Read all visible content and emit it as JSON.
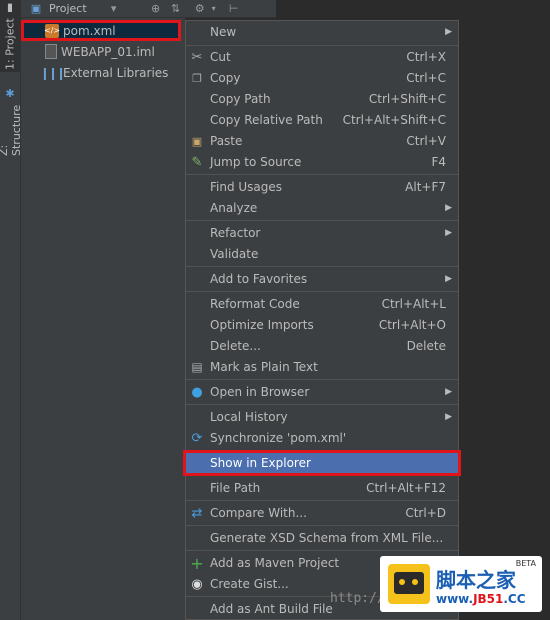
{
  "toolstrip": {
    "project_tab": "1: Project",
    "structure_tab": "Z: Structure"
  },
  "toolbar": {
    "title": "Project",
    "icons": [
      "dropdown-icon",
      "target-icon",
      "collapse-icon",
      "gear-icon",
      "pin-icon"
    ]
  },
  "tree": {
    "items": [
      {
        "label": "pom.xml",
        "icon": "xml-file-icon",
        "selected": true
      },
      {
        "label": "WEBAPP_01.iml",
        "icon": "iml-file-icon",
        "selected": false
      },
      {
        "label": "External Libraries",
        "icon": "libraries-icon",
        "selected": false
      }
    ]
  },
  "menu": {
    "items": [
      {
        "label": "New",
        "shortcut": "",
        "submenu": true,
        "icon": ""
      },
      {
        "label": "Cut",
        "shortcut": "Ctrl+X",
        "submenu": false,
        "icon": "scissors-icon"
      },
      {
        "label": "Copy",
        "shortcut": "Ctrl+C",
        "submenu": false,
        "icon": "copy-icon"
      },
      {
        "label": "Copy Path",
        "shortcut": "Ctrl+Shift+C",
        "submenu": false,
        "icon": ""
      },
      {
        "label": "Copy Relative Path",
        "shortcut": "Ctrl+Alt+Shift+C",
        "submenu": false,
        "icon": ""
      },
      {
        "label": "Paste",
        "shortcut": "Ctrl+V",
        "submenu": false,
        "icon": "paste-icon"
      },
      {
        "label": "Jump to Source",
        "shortcut": "F4",
        "submenu": false,
        "icon": "edit-icon"
      },
      {
        "label": "Find Usages",
        "shortcut": "Alt+F7",
        "submenu": false,
        "icon": ""
      },
      {
        "label": "Analyze",
        "shortcut": "",
        "submenu": true,
        "icon": ""
      },
      {
        "label": "Refactor",
        "shortcut": "",
        "submenu": true,
        "icon": ""
      },
      {
        "label": "Validate",
        "shortcut": "",
        "submenu": false,
        "icon": ""
      },
      {
        "label": "Add to Favorites",
        "shortcut": "",
        "submenu": true,
        "icon": ""
      },
      {
        "label": "Reformat Code",
        "shortcut": "Ctrl+Alt+L",
        "submenu": false,
        "icon": ""
      },
      {
        "label": "Optimize Imports",
        "shortcut": "Ctrl+Alt+O",
        "submenu": false,
        "icon": ""
      },
      {
        "label": "Delete...",
        "shortcut": "Delete",
        "submenu": false,
        "icon": ""
      },
      {
        "label": "Mark as Plain Text",
        "shortcut": "",
        "submenu": false,
        "icon": "plain-text-icon"
      },
      {
        "label": "Open in Browser",
        "shortcut": "",
        "submenu": true,
        "icon": "globe-icon"
      },
      {
        "label": "Local History",
        "shortcut": "",
        "submenu": true,
        "icon": ""
      },
      {
        "label": "Synchronize 'pom.xml'",
        "shortcut": "",
        "submenu": false,
        "icon": "sync-icon"
      },
      {
        "label": "Show in Explorer",
        "shortcut": "",
        "submenu": false,
        "icon": "",
        "highlighted": true
      },
      {
        "label": "File Path",
        "shortcut": "Ctrl+Alt+F12",
        "submenu": false,
        "icon": ""
      },
      {
        "label": "Compare With...",
        "shortcut": "Ctrl+D",
        "submenu": false,
        "icon": "compare-icon"
      },
      {
        "label": "Generate XSD Schema from XML File...",
        "shortcut": "",
        "submenu": false,
        "icon": ""
      },
      {
        "label": "Add as Maven Project",
        "shortcut": "",
        "submenu": false,
        "icon": "plus-icon"
      },
      {
        "label": "Create Gist...",
        "shortcut": "",
        "submenu": false,
        "icon": "github-icon"
      },
      {
        "label": "Add as Ant Build File",
        "shortcut": "",
        "submenu": false,
        "icon": ""
      }
    ]
  },
  "watermark": {
    "blog_text": "http://blog.",
    "logo_title": "脚本之家",
    "logo_beta": "BETA",
    "logo_url_prefix": "www.",
    "logo_url_mid": "JB51",
    "logo_url_suffix": ".CC"
  },
  "colors": {
    "menu_bg": "#3c3f41",
    "highlight": "#4b6eaf",
    "annotation_red": "#e0151b"
  }
}
